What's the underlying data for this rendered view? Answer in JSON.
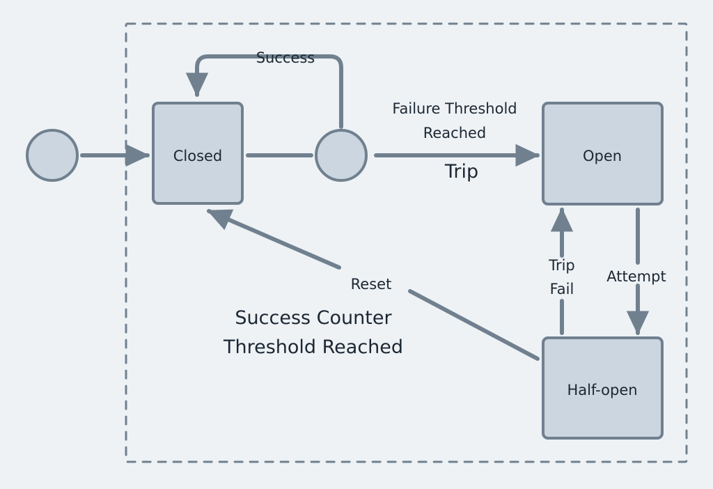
{
  "diagram": {
    "title": "Circuit Breaker State Diagram",
    "type": "state-machine",
    "background_color": "#eef2f5",
    "node_fill": "#ccd6e0",
    "node_stroke": "#70808f",
    "edge_color": "#70808f",
    "text_color": "#1b2733",
    "boundary": {
      "name": "state-machine-boundary",
      "style": "dashed"
    },
    "nodes": [
      {
        "id": "start",
        "label": "",
        "shape": "circle",
        "name": "start-node"
      },
      {
        "id": "closed",
        "label": "Closed",
        "shape": "rounded-rect",
        "name": "state-closed"
      },
      {
        "id": "choice",
        "label": "",
        "shape": "circle",
        "name": "choice-node"
      },
      {
        "id": "open",
        "label": "Open",
        "shape": "rounded-rect",
        "name": "state-open"
      },
      {
        "id": "halfopen",
        "label": "Half-open",
        "shape": "rounded-rect",
        "name": "state-half-open"
      }
    ],
    "edges": [
      {
        "id": "e-start-closed",
        "from": "start",
        "to": "closed",
        "label": ""
      },
      {
        "id": "e-closed-choice",
        "from": "closed",
        "to": "choice",
        "label": ""
      },
      {
        "id": "e-success",
        "from": "choice",
        "to": "closed",
        "label": "Success"
      },
      {
        "id": "e-trip",
        "from": "choice",
        "to": "open",
        "label_above_1": "Failure Threshold",
        "label_above_2": "Reached",
        "label_below": "Trip"
      },
      {
        "id": "e-attempt",
        "from": "open",
        "to": "halfopen",
        "label": "Attempt"
      },
      {
        "id": "e-tripfail",
        "from": "halfopen",
        "to": "open",
        "label_line_1": "Trip",
        "label_line_2": "Fail"
      },
      {
        "id": "e-reset",
        "from": "halfopen",
        "to": "closed",
        "label_small": "Reset",
        "label_big_1": "Success Counter",
        "label_big_2": "Threshold Reached"
      }
    ]
  },
  "labels": {
    "closed": "Closed",
    "open": "Open",
    "half_open": "Half-open",
    "success": "Success",
    "failure_threshold": "Failure Threshold",
    "reached": "Reached",
    "trip": "Trip",
    "attempt": "Attempt",
    "trip_fail_1": "Trip",
    "trip_fail_2": "Fail",
    "reset": "Reset",
    "success_counter": "Success Counter",
    "threshold_reached": "Threshold Reached"
  }
}
